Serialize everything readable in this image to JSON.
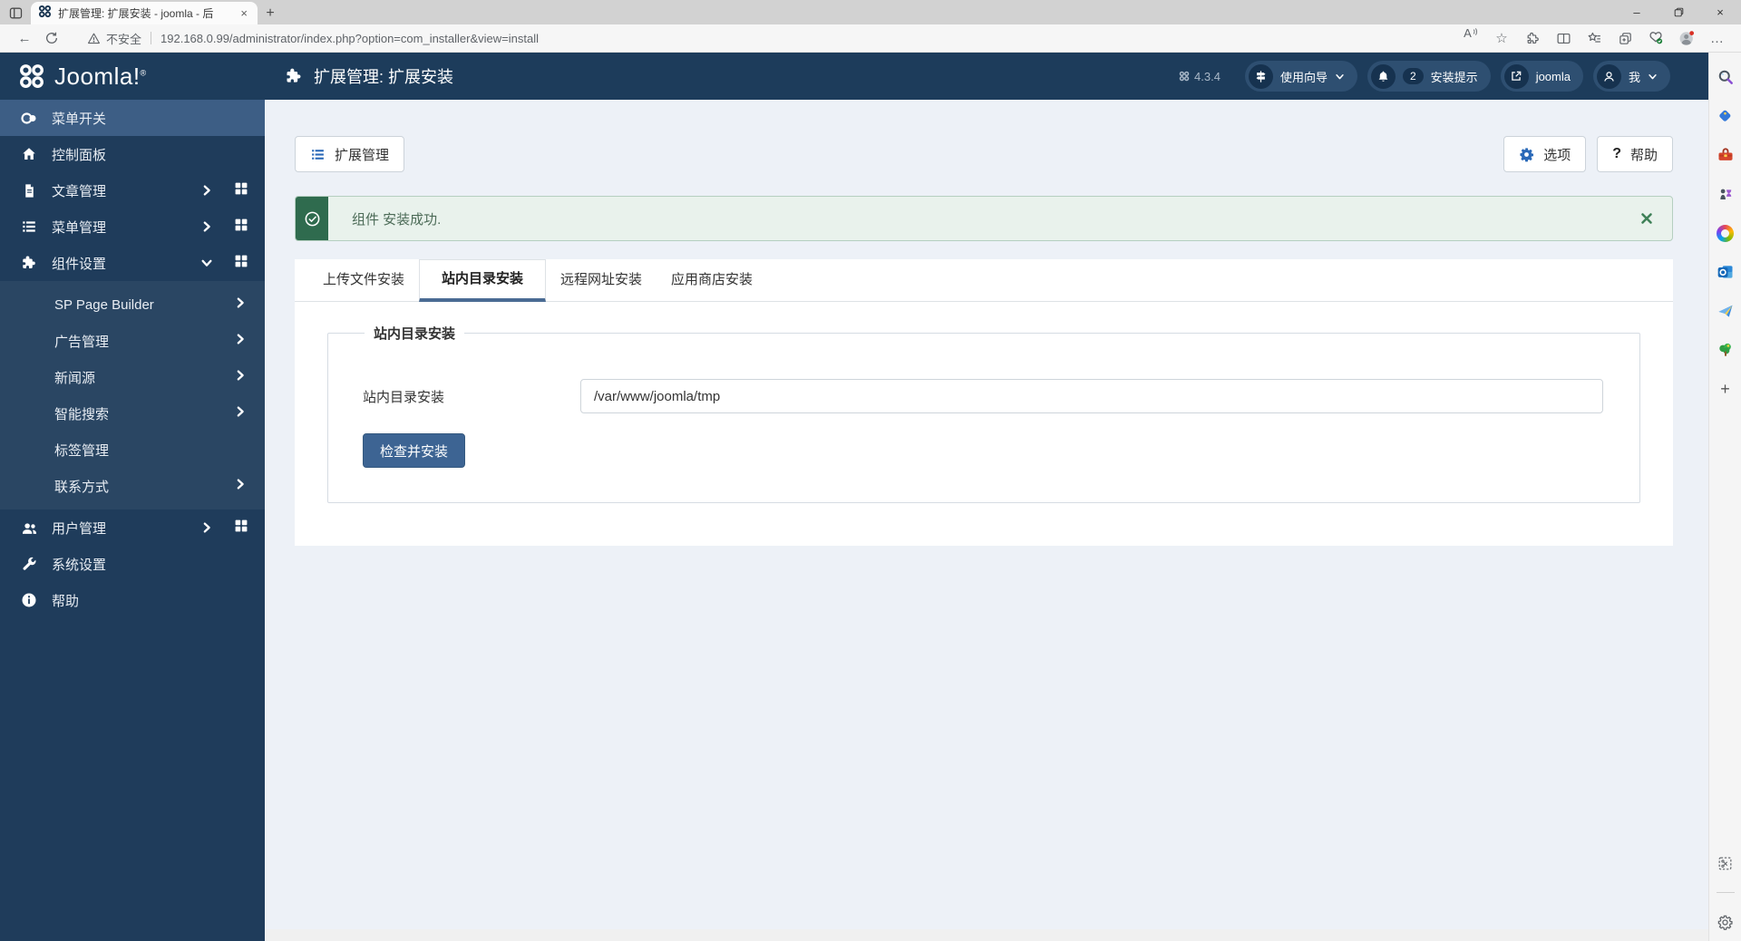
{
  "browser": {
    "tab_title": "扩展管理: 扩展安装 - joomla - 后",
    "security_label": "不安全",
    "url": "192.168.0.99/administrator/index.php?option=com_installer&view=install",
    "glyphs": {
      "close": "×",
      "new_tab": "+",
      "minimize": "–",
      "back": "←",
      "more": "…",
      "star": "☆",
      "read_aloud": "A",
      "add_sidebar": "+"
    }
  },
  "admin_header": {
    "title": "扩展管理: 扩展安装",
    "version": "4.3.4",
    "guide_label": "使用向导",
    "notifications_count": "2",
    "notifications_label": "安装提示",
    "site_name": "joomla",
    "user_label": "我"
  },
  "sidebar": {
    "logo_text": "Joomla!",
    "items": [
      {
        "label": "菜单开关"
      },
      {
        "label": "控制面板"
      },
      {
        "label": "文章管理"
      },
      {
        "label": "菜单管理"
      },
      {
        "label": "组件设置"
      },
      {
        "label": "用户管理"
      },
      {
        "label": "系统设置"
      },
      {
        "label": "帮助"
      }
    ],
    "submenu": [
      {
        "label": "SP Page Builder"
      },
      {
        "label": "广告管理"
      },
      {
        "label": "新闻源"
      },
      {
        "label": "智能搜索"
      },
      {
        "label": "标签管理"
      },
      {
        "label": "联系方式"
      }
    ]
  },
  "toolbar": {
    "manage_label": "扩展管理",
    "options_label": "选项",
    "help_label": "帮助",
    "help_glyph": "?"
  },
  "alert": {
    "message": "组件 安装成功."
  },
  "tabs": {
    "items": [
      "上传文件安装",
      "站内目录安装",
      "远程网址安装",
      "应用商店安装"
    ]
  },
  "form": {
    "legend": "站内目录安装",
    "field_label": "站内目录安装",
    "field_value": "/var/www/joomla/tmp",
    "submit_label": "检查并安装"
  },
  "colors": {
    "header_navy": "#1d3c5b",
    "sidebar_active": "#3d5e85",
    "success_green": "#2f6b4e",
    "primary_button": "#3d6493",
    "accent_blue": "#2a69b8"
  }
}
